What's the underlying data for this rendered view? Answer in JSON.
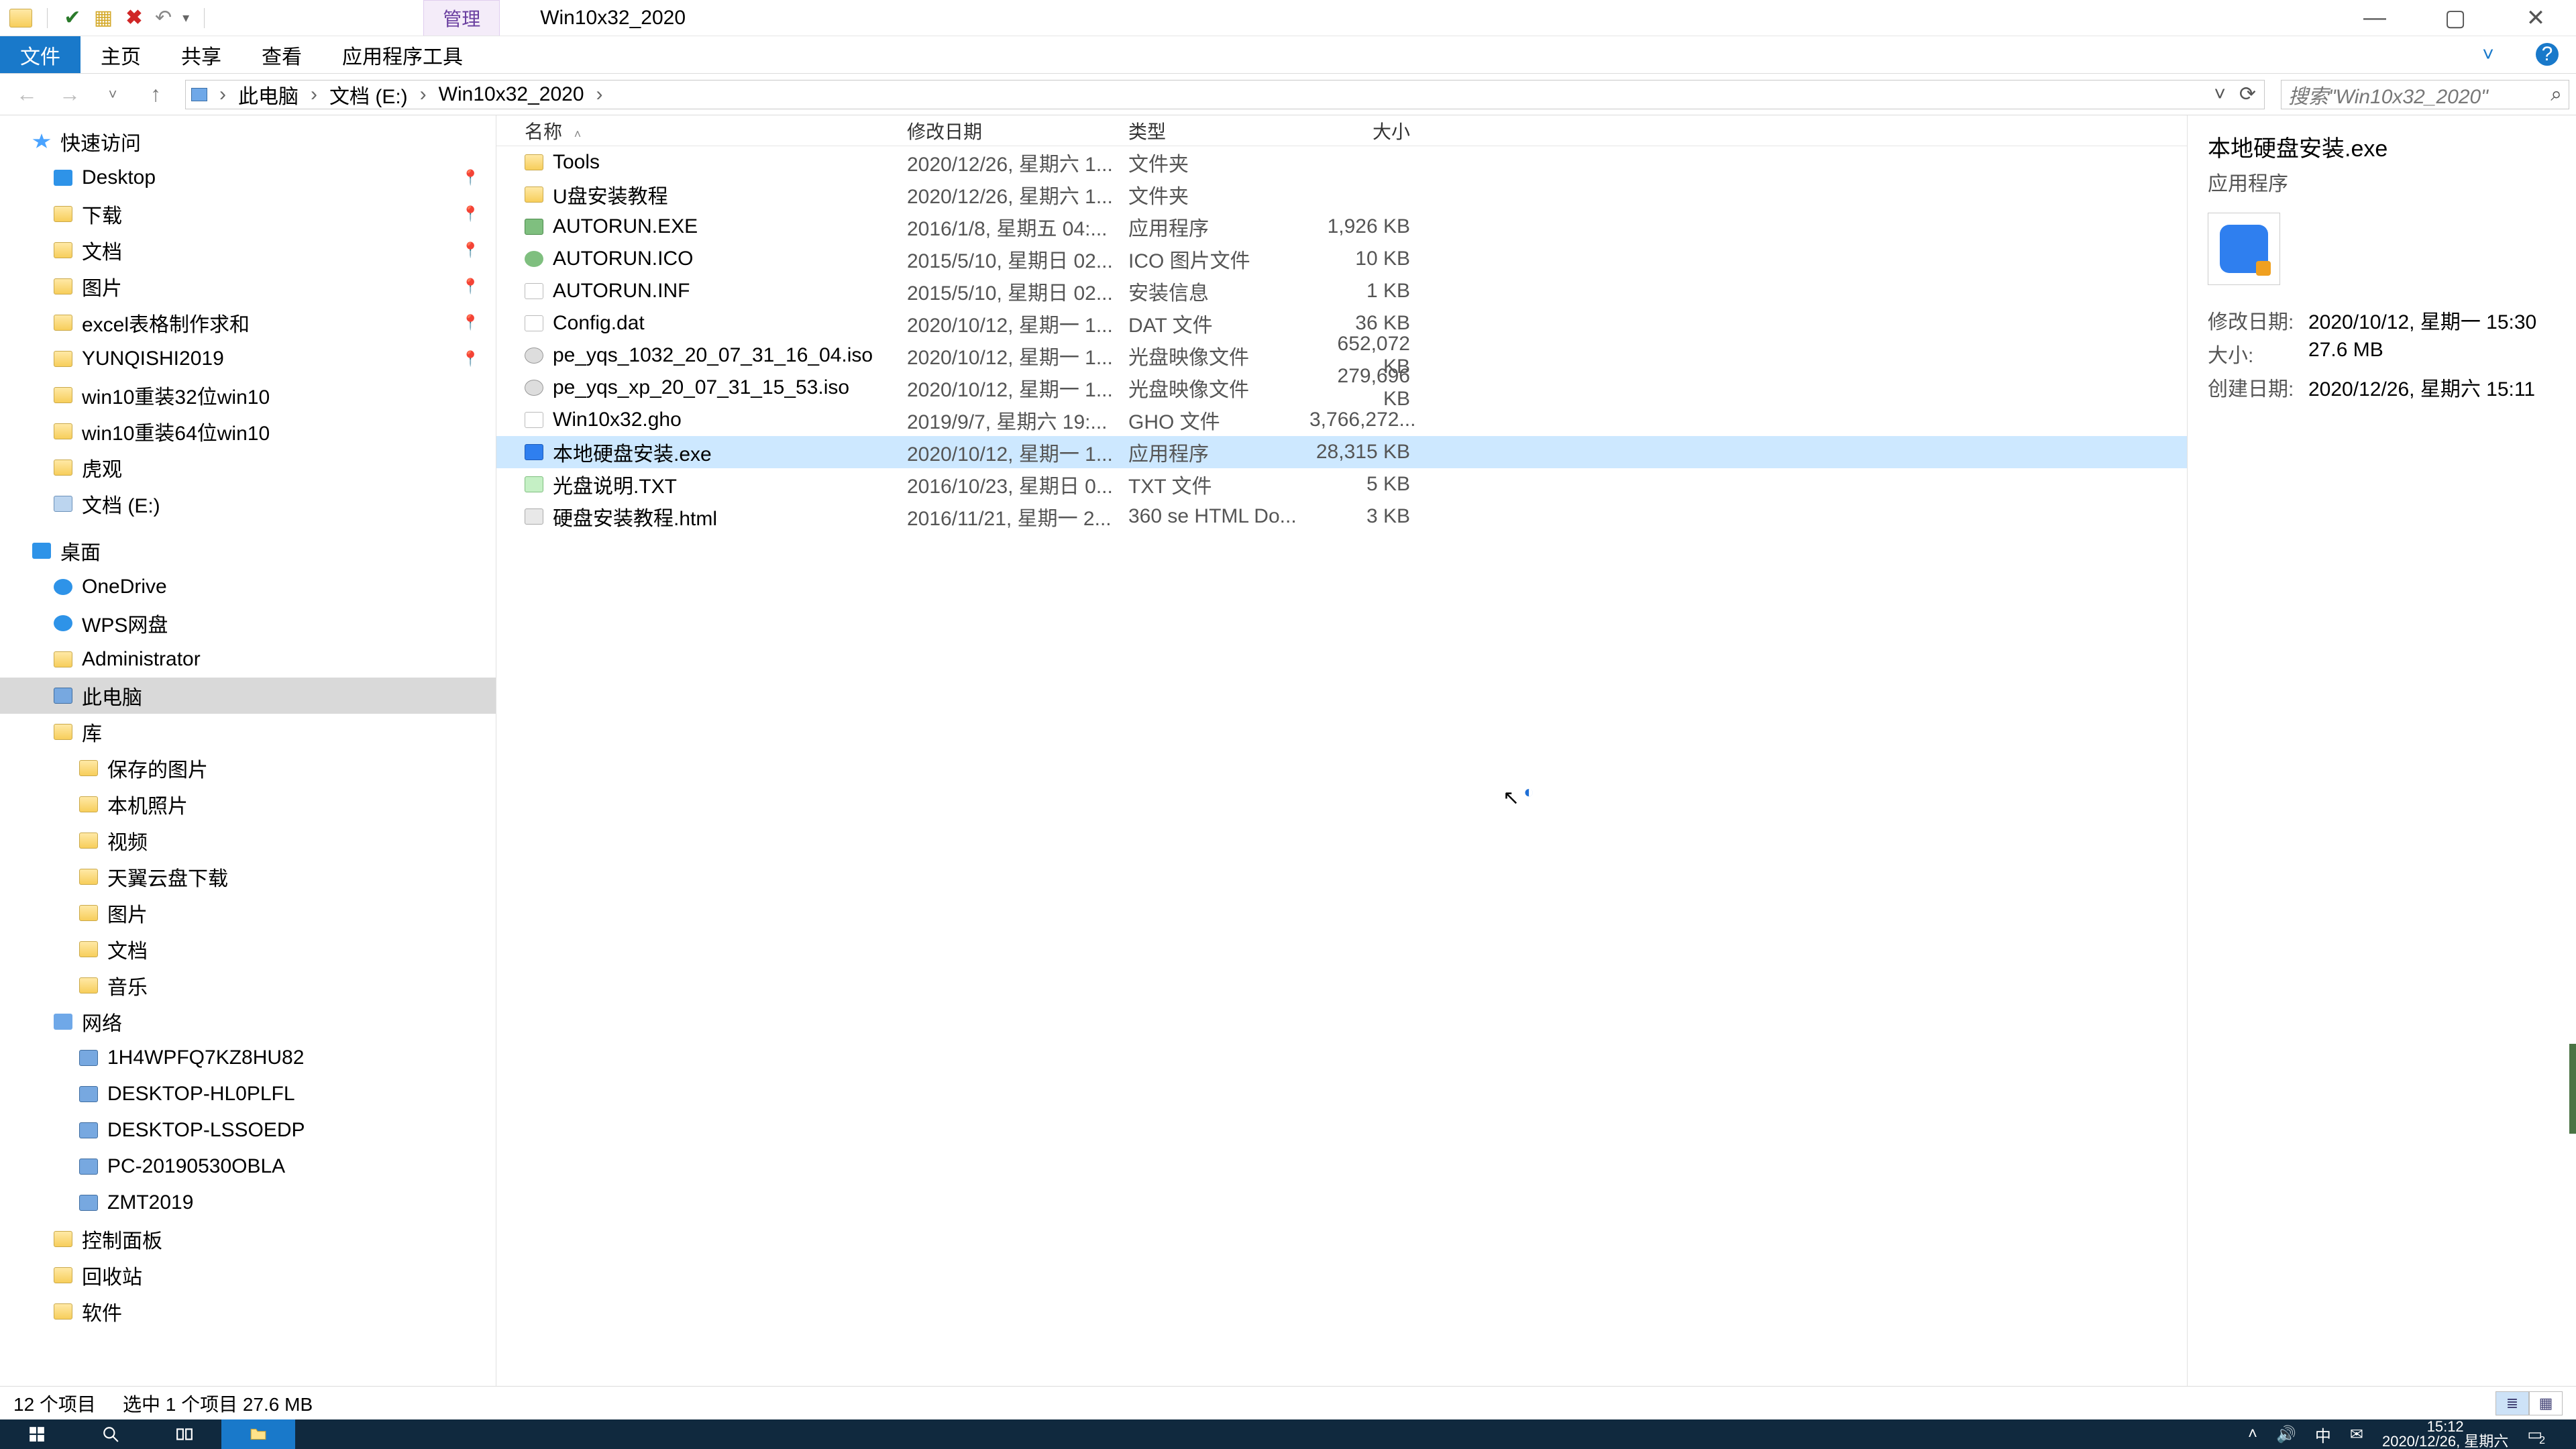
{
  "titlebar": {
    "manage_tab": "管理",
    "window_title": "Win10x32_2020",
    "min": "—",
    "max": "▢",
    "close": "✕"
  },
  "ribbon": {
    "file": "文件",
    "home": "主页",
    "share": "共享",
    "view": "查看",
    "apptools": "应用程序工具",
    "expand": "˅",
    "help": "?"
  },
  "nav": {
    "back": "←",
    "fwd": "→",
    "dd": "˅",
    "up": "↑",
    "crumbs": [
      "此电脑",
      "文档 (E:)",
      "Win10x32_2020"
    ],
    "chev": "›",
    "addr_dd": "˅",
    "refresh": "⟳",
    "search_placeholder": "搜索\"Win10x32_2020\"",
    "search_icon": "🔍"
  },
  "tree": [
    {
      "lvl": 0,
      "ic": "ic-star",
      "label": "快速访问",
      "pin": ""
    },
    {
      "lvl": 1,
      "ic": "ic-desktop",
      "label": "Desktop",
      "pin": "📌"
    },
    {
      "lvl": 1,
      "ic": "ic-fold",
      "label": "下载",
      "pin": "📌"
    },
    {
      "lvl": 1,
      "ic": "ic-fold",
      "label": "文档",
      "pin": "📌"
    },
    {
      "lvl": 1,
      "ic": "ic-fold",
      "label": "图片",
      "pin": "📌"
    },
    {
      "lvl": 1,
      "ic": "ic-fold",
      "label": "excel表格制作求和",
      "pin": "📌"
    },
    {
      "lvl": 1,
      "ic": "ic-fold",
      "label": "YUNQISHI2019",
      "pin": "📌"
    },
    {
      "lvl": 1,
      "ic": "ic-fold",
      "label": "win10重装32位win10",
      "pin": ""
    },
    {
      "lvl": 1,
      "ic": "ic-fold",
      "label": "win10重装64位win10",
      "pin": ""
    },
    {
      "lvl": 1,
      "ic": "ic-fold",
      "label": "虎观",
      "pin": ""
    },
    {
      "lvl": 1,
      "ic": "ic-drive",
      "label": "文档 (E:)",
      "pin": ""
    },
    {
      "lvl": 0,
      "ic": "ic-desktop",
      "label": "桌面",
      "pin": "",
      "spacer": true
    },
    {
      "lvl": 1,
      "ic": "ic-cloud",
      "label": "OneDrive",
      "pin": ""
    },
    {
      "lvl": 1,
      "ic": "ic-cloud",
      "label": "WPS网盘",
      "pin": ""
    },
    {
      "lvl": 1,
      "ic": "ic-fold",
      "label": "Administrator",
      "pin": ""
    },
    {
      "lvl": 1,
      "ic": "ic-pc",
      "label": "此电脑",
      "pin": "",
      "sel": true
    },
    {
      "lvl": 1,
      "ic": "ic-fold",
      "label": "库",
      "pin": ""
    },
    {
      "lvl": 2,
      "ic": "ic-fold",
      "label": "保存的图片",
      "pin": ""
    },
    {
      "lvl": 2,
      "ic": "ic-fold",
      "label": "本机照片",
      "pin": ""
    },
    {
      "lvl": 2,
      "ic": "ic-fold",
      "label": "视频",
      "pin": ""
    },
    {
      "lvl": 2,
      "ic": "ic-fold",
      "label": "天翼云盘下载",
      "pin": ""
    },
    {
      "lvl": 2,
      "ic": "ic-fold",
      "label": "图片",
      "pin": ""
    },
    {
      "lvl": 2,
      "ic": "ic-fold",
      "label": "文档",
      "pin": ""
    },
    {
      "lvl": 2,
      "ic": "ic-fold",
      "label": "音乐",
      "pin": ""
    },
    {
      "lvl": 1,
      "ic": "ic-net",
      "label": "网络",
      "pin": ""
    },
    {
      "lvl": 2,
      "ic": "ic-pc",
      "label": "1H4WPFQ7KZ8HU82",
      "pin": ""
    },
    {
      "lvl": 2,
      "ic": "ic-pc",
      "label": "DESKTOP-HL0PLFL",
      "pin": ""
    },
    {
      "lvl": 2,
      "ic": "ic-pc",
      "label": "DESKTOP-LSSOEDP",
      "pin": ""
    },
    {
      "lvl": 2,
      "ic": "ic-pc",
      "label": "PC-20190530OBLA",
      "pin": ""
    },
    {
      "lvl": 2,
      "ic": "ic-pc",
      "label": "ZMT2019",
      "pin": ""
    },
    {
      "lvl": 1,
      "ic": "ic-fold",
      "label": "控制面板",
      "pin": ""
    },
    {
      "lvl": 1,
      "ic": "ic-fold",
      "label": "回收站",
      "pin": ""
    },
    {
      "lvl": 1,
      "ic": "ic-fold",
      "label": "软件",
      "pin": ""
    }
  ],
  "columns": {
    "name": "名称",
    "date": "修改日期",
    "type": "类型",
    "size": "大小",
    "sort": "˄"
  },
  "files": [
    {
      "ic": "fi-fold",
      "name": "Tools",
      "date": "2020/12/26, 星期六 1...",
      "type": "文件夹",
      "size": ""
    },
    {
      "ic": "fi-fold",
      "name": "U盘安装教程",
      "date": "2020/12/26, 星期六 1...",
      "type": "文件夹",
      "size": ""
    },
    {
      "ic": "fi-exe",
      "name": "AUTORUN.EXE",
      "date": "2016/1/8, 星期五 04:...",
      "type": "应用程序",
      "size": "1,926 KB"
    },
    {
      "ic": "fi-ico",
      "name": "AUTORUN.ICO",
      "date": "2015/5/10, 星期日 02...",
      "type": "ICO 图片文件",
      "size": "10 KB"
    },
    {
      "ic": "fi-file",
      "name": "AUTORUN.INF",
      "date": "2015/5/10, 星期日 02...",
      "type": "安装信息",
      "size": "1 KB"
    },
    {
      "ic": "fi-file",
      "name": "Config.dat",
      "date": "2020/10/12, 星期一 1...",
      "type": "DAT 文件",
      "size": "36 KB"
    },
    {
      "ic": "fi-disc",
      "name": "pe_yqs_1032_20_07_31_16_04.iso",
      "date": "2020/10/12, 星期一 1...",
      "type": "光盘映像文件",
      "size": "652,072 KB"
    },
    {
      "ic": "fi-disc",
      "name": "pe_yqs_xp_20_07_31_15_53.iso",
      "date": "2020/10/12, 星期一 1...",
      "type": "光盘映像文件",
      "size": "279,696 KB"
    },
    {
      "ic": "fi-file",
      "name": "Win10x32.gho",
      "date": "2019/9/7, 星期六 19:...",
      "type": "GHO 文件",
      "size": "3,766,272..."
    },
    {
      "ic": "fi-app",
      "name": "本地硬盘安装.exe",
      "date": "2020/10/12, 星期一 1...",
      "type": "应用程序",
      "size": "28,315 KB",
      "sel": true
    },
    {
      "ic": "fi-txt",
      "name": "光盘说明.TXT",
      "date": "2016/10/23, 星期日 0...",
      "type": "TXT 文件",
      "size": "5 KB"
    },
    {
      "ic": "fi-html",
      "name": "硬盘安装教程.html",
      "date": "2016/11/21, 星期一 2...",
      "type": "360 se HTML Do...",
      "size": "3 KB"
    }
  ],
  "details": {
    "name": "本地硬盘安装.exe",
    "sub": "应用程序",
    "k_modified": "修改日期:",
    "v_modified": "2020/10/12, 星期一 15:30",
    "k_size": "大小:",
    "v_size": "27.6 MB",
    "k_created": "创建日期:",
    "v_created": "2020/12/26, 星期六 15:11"
  },
  "status": {
    "count": "12 个项目",
    "selection": "选中 1 个项目  27.6 MB"
  },
  "taskbar": {
    "ime": "中",
    "time": "15:12",
    "date": "2020/12/26, 星期六",
    "badge": "2"
  }
}
